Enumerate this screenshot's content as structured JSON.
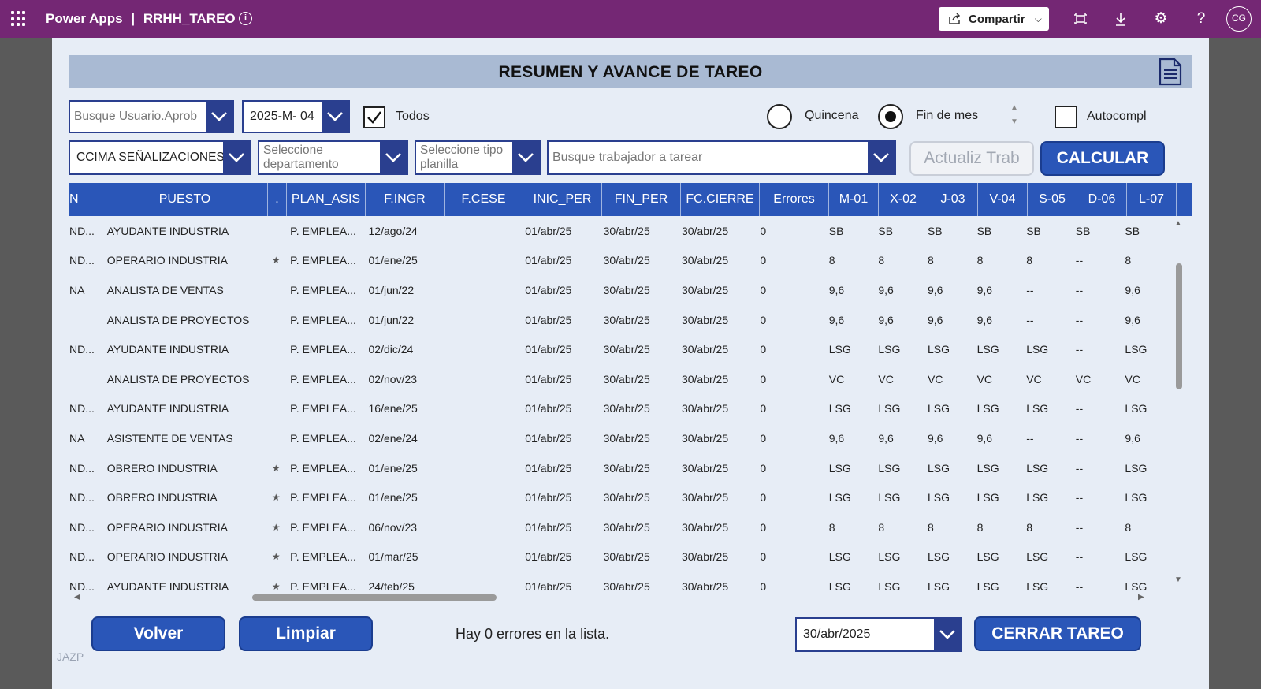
{
  "topbar": {
    "brand": "Power Apps",
    "separator": "|",
    "app_name": "RRHH_TAREO",
    "share_label": "Compartir",
    "avatar_initials": "CG"
  },
  "header": {
    "title": "RESUMEN Y AVANCE DE TAREO"
  },
  "filters": {
    "user_search_placeholder": "Busque Usuario.Aprob",
    "period_value": "2025-M- 04",
    "todos_label": "Todos",
    "todos_checked": true,
    "quincena_label": "Quincena",
    "fin_mes_label": "Fin de mes",
    "selected_period_type": "Fin de mes",
    "autocompl_label": "Autocompl",
    "company_value": "CCIMA SEÑALIZACIONES S",
    "department_placeholder": "Seleccione departamento",
    "planilla_placeholder": "Seleccione tipo planilla",
    "worker_search_placeholder": "Busque trabajador a tarear",
    "actualiz_label": "Actualiz Trab",
    "calcular_label": "CALCULAR"
  },
  "grid": {
    "columns": [
      "N",
      "PUESTO",
      ".",
      "PLAN_ASIS",
      "F.INGR",
      "F.CESE",
      "INIC_PER",
      "FIN_PER",
      "FC.CIERRE",
      "Errores",
      "M-01",
      "X-02",
      "J-03",
      "V-04",
      "S-05",
      "D-06",
      "L-07"
    ],
    "rows": [
      [
        "ND...",
        "AYUDANTE INDUSTRIA",
        "",
        "P. EMPLEA...",
        "12/ago/24",
        "",
        "01/abr/25",
        "30/abr/25",
        "30/abr/25",
        "0",
        "SB",
        "SB",
        "SB",
        "SB",
        "SB",
        "SB",
        "SB"
      ],
      [
        "ND...",
        "OPERARIO INDUSTRIA",
        "★",
        "P. EMPLEA...",
        "01/ene/25",
        "",
        "01/abr/25",
        "30/abr/25",
        "30/abr/25",
        "0",
        "8",
        "8",
        "8",
        "8",
        "8",
        "--",
        "8"
      ],
      [
        "NA",
        "ANALISTA DE VENTAS",
        "",
        "P. EMPLEA...",
        "01/jun/22",
        "",
        "01/abr/25",
        "30/abr/25",
        "30/abr/25",
        "0",
        "9,6",
        "9,6",
        "9,6",
        "9,6",
        "--",
        "--",
        "9,6"
      ],
      [
        "",
        "ANALISTA DE PROYECTOS",
        "",
        "P. EMPLEA...",
        "01/jun/22",
        "",
        "01/abr/25",
        "30/abr/25",
        "30/abr/25",
        "0",
        "9,6",
        "9,6",
        "9,6",
        "9,6",
        "--",
        "--",
        "9,6"
      ],
      [
        "ND...",
        "AYUDANTE INDUSTRIA",
        "",
        "P. EMPLEA...",
        "02/dic/24",
        "",
        "01/abr/25",
        "30/abr/25",
        "30/abr/25",
        "0",
        "LSG",
        "LSG",
        "LSG",
        "LSG",
        "LSG",
        "--",
        "LSG"
      ],
      [
        "",
        "ANALISTA DE PROYECTOS",
        "",
        "P. EMPLEA...",
        "02/nov/23",
        "",
        "01/abr/25",
        "30/abr/25",
        "30/abr/25",
        "0",
        "VC",
        "VC",
        "VC",
        "VC",
        "VC",
        "VC",
        "VC"
      ],
      [
        "ND...",
        "AYUDANTE INDUSTRIA",
        "",
        "P. EMPLEA...",
        "16/ene/25",
        "",
        "01/abr/25",
        "30/abr/25",
        "30/abr/25",
        "0",
        "LSG",
        "LSG",
        "LSG",
        "LSG",
        "LSG",
        "--",
        "LSG"
      ],
      [
        "NA",
        "ASISTENTE DE VENTAS",
        "",
        "P. EMPLEA...",
        "02/ene/24",
        "",
        "01/abr/25",
        "30/abr/25",
        "30/abr/25",
        "0",
        "9,6",
        "9,6",
        "9,6",
        "9,6",
        "--",
        "--",
        "9,6"
      ],
      [
        "ND...",
        "OBRERO INDUSTRIA",
        "★",
        "P. EMPLEA...",
        "01/ene/25",
        "",
        "01/abr/25",
        "30/abr/25",
        "30/abr/25",
        "0",
        "LSG",
        "LSG",
        "LSG",
        "LSG",
        "LSG",
        "--",
        "LSG"
      ],
      [
        "ND...",
        "OBRERO INDUSTRIA",
        "★",
        "P. EMPLEA...",
        "01/ene/25",
        "",
        "01/abr/25",
        "30/abr/25",
        "30/abr/25",
        "0",
        "LSG",
        "LSG",
        "LSG",
        "LSG",
        "LSG",
        "--",
        "LSG"
      ],
      [
        "ND...",
        "OPERARIO INDUSTRIA",
        "★",
        "P. EMPLEA...",
        "06/nov/23",
        "",
        "01/abr/25",
        "30/abr/25",
        "30/abr/25",
        "0",
        "8",
        "8",
        "8",
        "8",
        "8",
        "--",
        "8"
      ],
      [
        "ND...",
        "OPERARIO INDUSTRIA",
        "★",
        "P. EMPLEA...",
        "01/mar/25",
        "",
        "01/abr/25",
        "30/abr/25",
        "30/abr/25",
        "0",
        "LSG",
        "LSG",
        "LSG",
        "LSG",
        "LSG",
        "--",
        "LSG"
      ],
      [
        "ND...",
        "AYUDANTE INDUSTRIA",
        "★",
        "P. EMPLEA...",
        "24/feb/25",
        "",
        "01/abr/25",
        "30/abr/25",
        "30/abr/25",
        "0",
        "LSG",
        "LSG",
        "LSG",
        "LSG",
        "LSG",
        "--",
        "LSG"
      ]
    ]
  },
  "footer": {
    "volver_label": "Volver",
    "limpiar_label": "Limpiar",
    "status_message": "Hay 0 errores en la lista.",
    "close_date_value": "30/abr/2025",
    "cerrar_label": "CERRAR TAREO",
    "watermark": "JAZP"
  },
  "colors": {
    "topbar": "#742774",
    "canvas": "#e7edf6",
    "header_band": "#a9bad3",
    "primary": "#2a56b8",
    "border": "#2a3f8f"
  }
}
